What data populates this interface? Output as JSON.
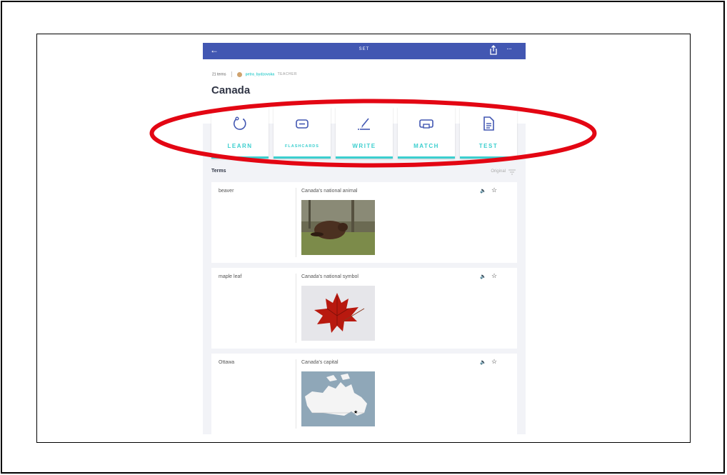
{
  "topbar": {
    "back_glyph": "←",
    "title": "SET",
    "more_glyph": "···"
  },
  "set": {
    "term_count": "21 terms",
    "creator": "petra_bydzovska",
    "creator_role": "TEACHER",
    "title": "Canada"
  },
  "modes": [
    {
      "label": "LEARN",
      "icon": "learn-icon"
    },
    {
      "label": "FLASHCARDS",
      "icon": "flashcards-icon"
    },
    {
      "label": "WRITE",
      "icon": "write-icon"
    },
    {
      "label": "MATCH",
      "icon": "match-icon"
    },
    {
      "label": "TEST",
      "icon": "test-icon"
    }
  ],
  "terms_section": {
    "heading": "Terms",
    "sort_label": "Original"
  },
  "terms": [
    {
      "term": "beaver",
      "definition": "Canada's national animal",
      "image": "beaver photo"
    },
    {
      "term": "maple leaf",
      "definition": "Canada's national symbol",
      "image": "red maple leaf photo"
    },
    {
      "term": "Ottawa",
      "definition": "Canada's capital",
      "image": "map of Canada"
    }
  ],
  "colors": {
    "topbar": "#4257b2",
    "accent": "#3ccfcf",
    "highlight": "#e30613"
  }
}
